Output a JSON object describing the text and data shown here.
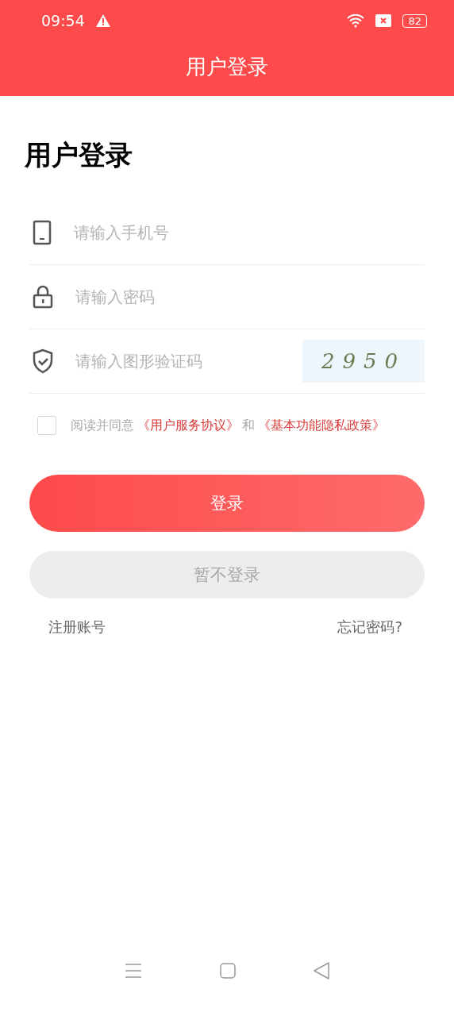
{
  "status_bar": {
    "time": "09:54",
    "battery": "82"
  },
  "header": {
    "title": "用户登录"
  },
  "heading": "用户登录",
  "fields": [
    {
      "kind": "phone",
      "placeholder": "请输入手机号"
    },
    {
      "kind": "password",
      "placeholder": "请输入密码"
    },
    {
      "kind": "captcha",
      "placeholder": "请输入图形验证码",
      "captcha": "2950"
    }
  ],
  "agreement": {
    "checked": false,
    "parts": [
      {
        "kind": "text",
        "text": "阅读并同意"
      },
      {
        "kind": "link",
        "text": "《用户服务协议》"
      },
      {
        "kind": "text",
        "text": "和"
      },
      {
        "kind": "link",
        "text": "《基本功能隐私政策》"
      }
    ]
  },
  "buttons": [
    {
      "kind": "primary",
      "label": "登录"
    },
    {
      "kind": "secondary",
      "label": "暂不登录"
    }
  ],
  "links": [
    "注册账号",
    "忘记密码?"
  ]
}
